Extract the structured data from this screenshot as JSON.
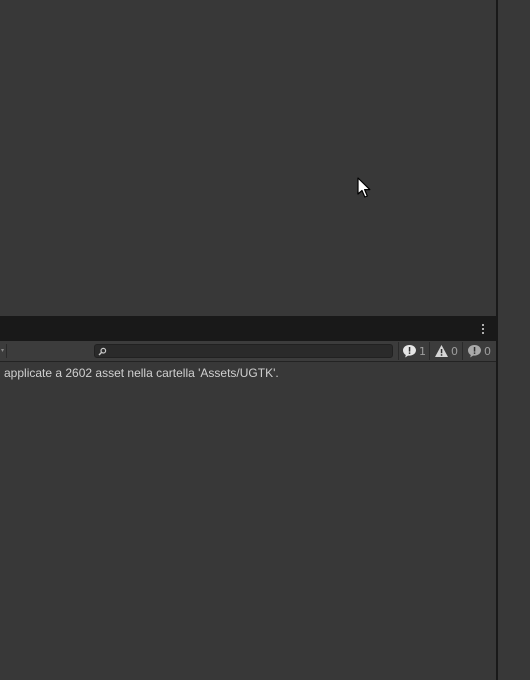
{
  "console": {
    "search": {
      "placeholder": "",
      "value": ""
    },
    "counts": {
      "info": "1",
      "warnings": "0",
      "errors": "0"
    },
    "log": [
      "applicate a 2602 asset nella cartella 'Assets/UGTK'."
    ]
  },
  "icons": {
    "menu": "kebab-menu-icon",
    "search": "magnifier-icon",
    "info": "info-bubble-icon",
    "warning": "warning-triangle-icon",
    "error": "error-bubble-icon",
    "cursor": "mouse-pointer-icon"
  },
  "colors": {
    "panel": "#383838",
    "header": "#191919",
    "toolbar": "#3c3c3c",
    "text": "#d0d0d0",
    "counter_text": "#9e9e9e"
  }
}
